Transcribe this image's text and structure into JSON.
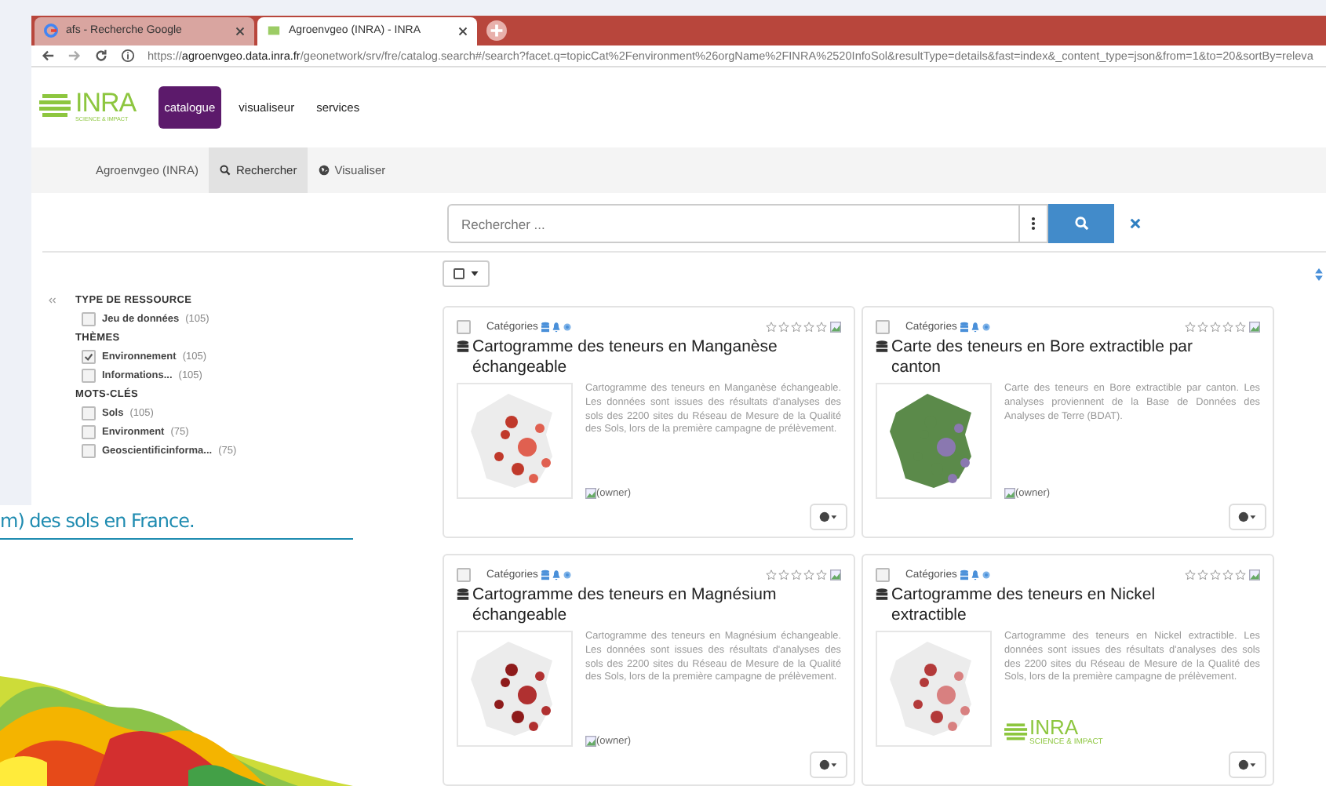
{
  "browser": {
    "tabs": [
      {
        "title": "afs - Recherche Google",
        "selected": false
      },
      {
        "title": "Agroenvgeo (INRA) - INRA",
        "selected": true
      }
    ],
    "address": {
      "scheme": "https://",
      "host": "agroenvgeo.data.inra.fr",
      "path": "/geonetwork/srv/fre/catalog.search#/search?facet.q=topicCat%2Fenvironment%26orgName%2FINRA%2520InfoSol&resultType=details&fast=index&_content_type=json&from=1&to=20&sortBy=releva"
    }
  },
  "header": {
    "logo": {
      "name": "INRA",
      "tagline": "SCIENCE & IMPACT"
    },
    "menu": [
      {
        "label": "catalogue",
        "selected": true
      },
      {
        "label": "visualiseur",
        "selected": false
      },
      {
        "label": "services",
        "selected": false
      }
    ]
  },
  "nav": [
    {
      "label": "Agroenvgeo (INRA)",
      "selected": false
    },
    {
      "label": "Rechercher",
      "selected": true
    },
    {
      "label": "Visualiser",
      "selected": false
    }
  ],
  "search": {
    "placeholder": "Rechercher ..."
  },
  "facets": [
    {
      "title": "TYPE DE RESSOURCE",
      "items": [
        {
          "label": "Jeu de données",
          "count": "(105)",
          "checked": false
        }
      ]
    },
    {
      "title": "THÈMES",
      "items": [
        {
          "label": "Environnement",
          "count": "(105)",
          "checked": true
        },
        {
          "label": "Informations...",
          "count": "(105)",
          "checked": false
        }
      ]
    },
    {
      "title": "MOTS-CLÉS",
      "items": [
        {
          "label": "Sols",
          "count": "(105)",
          "checked": false
        },
        {
          "label": "Environment",
          "count": "(75)",
          "checked": false
        },
        {
          "label": "Geoscientificinforma...",
          "count": "(75)",
          "checked": false
        }
      ]
    }
  ],
  "results": [
    {
      "checked": false,
      "category_label": "Catégories",
      "stars": 0,
      "title": "Cartogramme des teneurs en Manganèse échangeable",
      "description": "Cartogramme des teneurs en Manganèse échangeable. Les données sont issues des résultats d'analyses des sols des 2200 sites du Réseau de Mesure de la Qualité des Sols, lors de la première campagne de prélèvement.",
      "owner": "(owner)"
    },
    {
      "checked": false,
      "category_label": "Catégories",
      "stars": 0,
      "title": "Carte des teneurs en Bore extractible par canton",
      "description": "Carte des teneurs en Bore extractible par canton. Les analyses proviennent de la Base de Données des Analyses de Terre (BDAT).",
      "owner": "(owner)"
    },
    {
      "checked": false,
      "category_label": "Catégories",
      "stars": 0,
      "title": "Cartogramme des teneurs en Magnésium échangeable",
      "description": "Cartogramme des teneurs en Magnésium échangeable. Les données sont issues des résultats d'analyses des sols des 2200 sites du Réseau de Mesure de la Qualité des Sols, lors de la première campagne de prélèvement.",
      "owner": "(owner)"
    },
    {
      "checked": false,
      "category_label": "Catégories",
      "stars": 0,
      "title": "Cartogramme des teneurs en Nickel extractible",
      "description": "Cartogramme des teneurs en Nickel extractible. Les données sont issues des résultats d'analyses des sols des 2200 sites du Réseau de Mesure de la Qualité des Sols, lors de la première campagne de prélèvement.",
      "owner_logo": {
        "name": "INRA",
        "tagline": "SCIENCE & IMPACT"
      }
    }
  ],
  "slide": {
    "caption": "m) des sols en France."
  }
}
